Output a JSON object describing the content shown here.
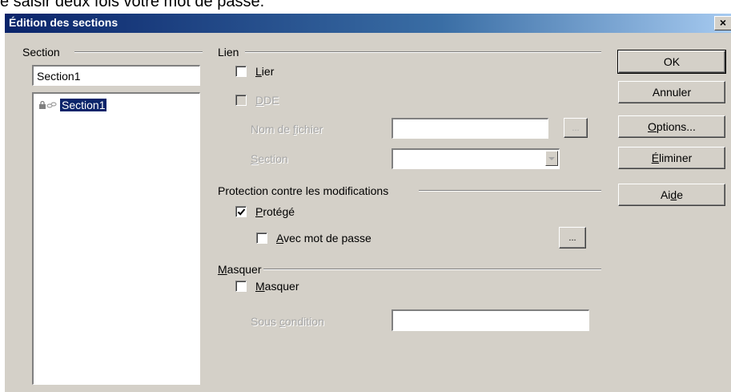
{
  "background_caption": "e saisir deux fois votre mot de passe.",
  "window": {
    "title": "Édition des sections",
    "close_glyph": "×"
  },
  "section_panel": {
    "title": "Section",
    "name_value": "Section1",
    "tree_items": [
      {
        "label": "Section1",
        "icons": [
          "lock-icon",
          "link-icon"
        ],
        "selected": true
      }
    ]
  },
  "link_group": {
    "title": "Lien",
    "link_checkbox": {
      "pre": "",
      "accel": "L",
      "post": "ier",
      "checked": false
    },
    "dde_checkbox": {
      "pre": "",
      "accel": "D",
      "post": "DE",
      "checked": false,
      "disabled": true
    },
    "filename": {
      "pre": "Nom de ",
      "accel": "f",
      "post": "ichier",
      "value": "",
      "browse": "..."
    },
    "section": {
      "pre": "",
      "accel": "S",
      "post": "ection",
      "value": ""
    }
  },
  "protection_group": {
    "title": "Protection contre les modifications",
    "protected_checkbox": {
      "pre": "",
      "accel": "P",
      "post": "rotégé",
      "checked": true
    },
    "password_checkbox": {
      "pre": "",
      "accel": "A",
      "post": "vec mot de passe",
      "checked": false
    },
    "password_button": "..."
  },
  "hide_group": {
    "title_accel": "M",
    "title_post": "asquer",
    "hide_checkbox": {
      "pre": "",
      "accel": "M",
      "post": "asquer",
      "checked": false
    },
    "condition": {
      "pre": "Sous ",
      "accel": "c",
      "post": "ondition",
      "value": ""
    }
  },
  "buttons": {
    "ok": {
      "label": "OK"
    },
    "cancel": {
      "label": "Annuler"
    },
    "options": {
      "pre": "",
      "accel": "O",
      "post": "ptions..."
    },
    "remove": {
      "pre": "",
      "accel": "É",
      "post": "liminer"
    },
    "help": {
      "pre": "Ai",
      "accel": "d",
      "post": "e"
    }
  },
  "colors": {
    "dialog_bg": "#d4d0c8",
    "title_start": "#0a246a",
    "title_end": "#a6caf0",
    "selection": "#0a246a"
  }
}
